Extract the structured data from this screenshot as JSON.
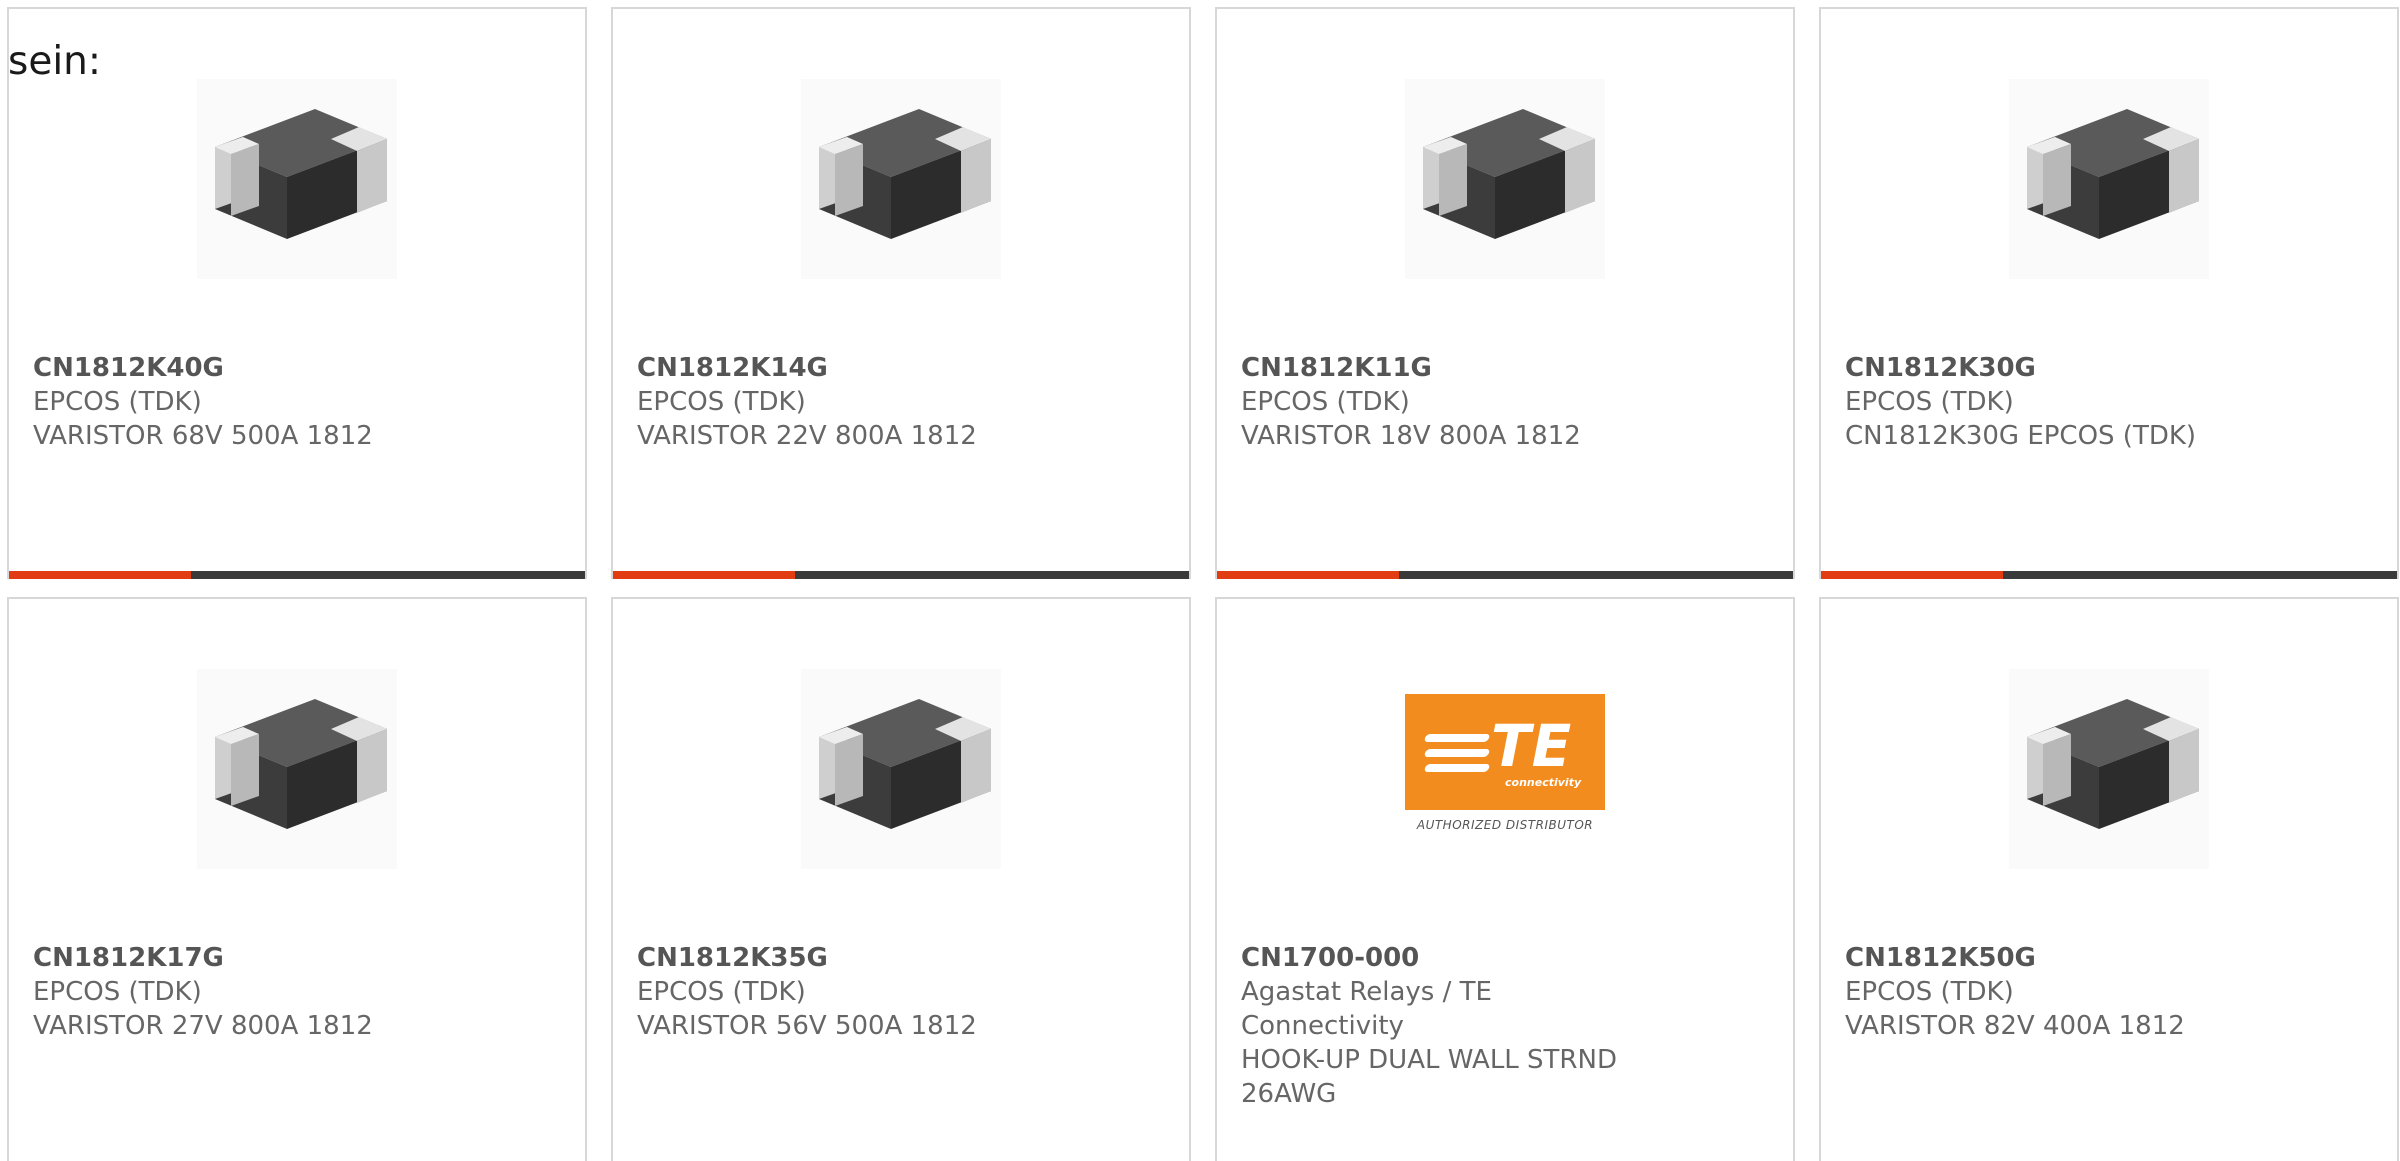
{
  "intro_text": "sein:",
  "colors": {
    "accent": "#e23c12",
    "bar": "#3a3a3a",
    "border": "#d7d7d7",
    "te_orange": "#f28c1e"
  },
  "products": [
    {
      "part": "CN1812K40G",
      "maker": "EPCOS (TDK)",
      "desc": "VARISTOR 68V 500A 1812",
      "image": "smd-varistor-chip"
    },
    {
      "part": "CN1812K14G",
      "maker": "EPCOS (TDK)",
      "desc": "VARISTOR 22V 800A 1812",
      "image": "smd-varistor-chip"
    },
    {
      "part": "CN1812K11G",
      "maker": "EPCOS (TDK)",
      "desc": "VARISTOR 18V 800A 1812",
      "image": "smd-varistor-chip"
    },
    {
      "part": "CN1812K30G",
      "maker": "EPCOS (TDK)",
      "desc": "CN1812K30G EPCOS (TDK)",
      "image": "smd-varistor-chip"
    },
    {
      "part": "CN1812K17G",
      "maker": "EPCOS (TDK)",
      "desc": "VARISTOR 27V 800A 1812",
      "image": "smd-varistor-chip"
    },
    {
      "part": "CN1812K35G",
      "maker": "EPCOS (TDK)",
      "desc": "VARISTOR 56V 500A 1812",
      "image": "smd-varistor-chip"
    },
    {
      "part": "CN1700-000",
      "maker": "Agastat Relays / TE Connectivity",
      "desc": "HOOK-UP DUAL WALL STRND 26AWG",
      "image": "te-connectivity-logo",
      "logo": {
        "word": "TE",
        "sub": "connectivity",
        "caption": "AUTHORIZED DISTRIBUTOR"
      }
    },
    {
      "part": "CN1812K50G",
      "maker": "EPCOS (TDK)",
      "desc": "VARISTOR 82V 400A 1812",
      "image": "smd-varistor-chip"
    }
  ]
}
